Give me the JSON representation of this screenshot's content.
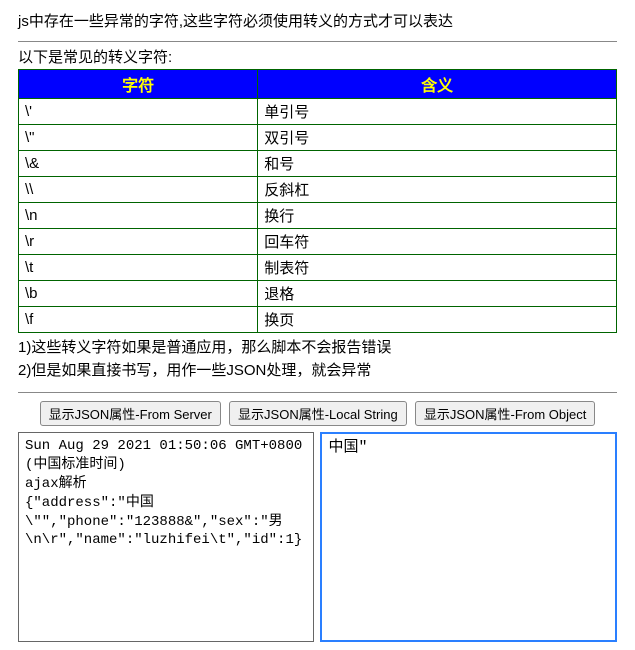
{
  "intro": "js中存在一些异常的字符,这些字符必须使用转义的方式才可以表达",
  "subtitle": "以下是常见的转义字符:",
  "table": {
    "headers": {
      "char": "字符",
      "meaning": "含义"
    },
    "rows": [
      {
        "char": "\\'",
        "meaning": "单引号"
      },
      {
        "char": "\\\"",
        "meaning": "双引号"
      },
      {
        "char": "\\&",
        "meaning": "和号"
      },
      {
        "char": "\\\\",
        "meaning": "反斜杠"
      },
      {
        "char": "\\n",
        "meaning": "换行"
      },
      {
        "char": "\\r",
        "meaning": "回车符"
      },
      {
        "char": "\\t",
        "meaning": "制表符"
      },
      {
        "char": "\\b",
        "meaning": "退格"
      },
      {
        "char": "\\f",
        "meaning": "换页"
      }
    ]
  },
  "notes": {
    "line1": "1)这些转义字符如果是普通应用，那么脚本不会报告错误",
    "line2": "2)但是如果直接书写，用作一些JSON处理，就会异常"
  },
  "buttons": {
    "from_server": "显示JSON属性-From Server",
    "local_string": "显示JSON属性-Local String",
    "from_object": "显示JSON属性-From Object"
  },
  "left_pane": "Sun Aug 29 2021 01:50:06 GMT+0800 (中国标准时间)\najax解析\n{\"address\":\"中国\\\"\",\"phone\":\"123888&\",\"sex\":\"男\\n\\r\",\"name\":\"luzhifei\\t\",\"id\":1}",
  "right_pane": "中国\""
}
